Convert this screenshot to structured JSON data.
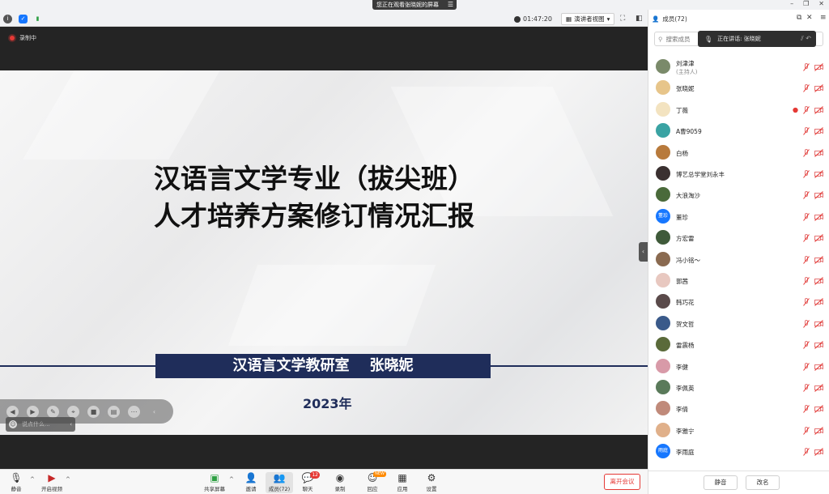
{
  "window": {
    "share_banner": "您正在观看张晓妮的屏幕",
    "timer": "01:47:20",
    "view_mode": "演讲者视图"
  },
  "stage": {
    "recording_label": "录制中",
    "slide": {
      "title_line1": "汉语言文学专业（拔尖班）",
      "title_line2": "人才培养方案修订情况汇报",
      "band_text": "汉语言文学教研室    张晓妮",
      "year": "2023年"
    },
    "chat_placeholder": "说点什么..."
  },
  "toolbar": {
    "mute": "静音",
    "start_video": "开启视频",
    "share_screen": "共享屏幕",
    "invite": "邀请",
    "members": "成员(72)",
    "chat": "聊天",
    "chat_badge": "12",
    "record": "录制",
    "reactions": "回应",
    "reactions_badge": "NEW",
    "apps": "应用",
    "settings": "设置",
    "leave": "离开会议"
  },
  "panel": {
    "title": "成员(72)",
    "search_placeholder": "搜索成员",
    "speaking": "正在讲话: 张晓妮",
    "participants": [
      {
        "name": "刘津津",
        "role": "(主持人)",
        "avatar_color": "#7a8a6a",
        "avatar_text": ""
      },
      {
        "name": "张晓妮",
        "role": "",
        "avatar_color": "#e7c58a",
        "avatar_text": ""
      },
      {
        "name": "丁薇",
        "role": "",
        "avatar_color": "#f3e3c0",
        "avatar_text": "",
        "recording": true
      },
      {
        "name": "A曹9059",
        "role": "",
        "avatar_color": "#3aa3a3",
        "avatar_text": ""
      },
      {
        "name": "白杨",
        "role": "",
        "avatar_color": "#b87a3c",
        "avatar_text": ""
      },
      {
        "name": "博艺总学堂刘永丰",
        "role": "",
        "avatar_color": "#3a3030",
        "avatar_text": ""
      },
      {
        "name": "大浪淘沙",
        "role": "",
        "avatar_color": "#4a6a3a",
        "avatar_text": ""
      },
      {
        "name": "董珍",
        "role": "",
        "avatar_color": "#1677ff",
        "avatar_text": "董珍"
      },
      {
        "name": "方宏雷",
        "role": "",
        "avatar_color": "#3f5a3a",
        "avatar_text": ""
      },
      {
        "name": "冯小铭～",
        "role": "",
        "avatar_color": "#8a6a50",
        "avatar_text": ""
      },
      {
        "name": "郭茜",
        "role": "",
        "avatar_color": "#e8c8c0",
        "avatar_text": ""
      },
      {
        "name": "韩巧花",
        "role": "",
        "avatar_color": "#5a4a4a",
        "avatar_text": ""
      },
      {
        "name": "贺文哲",
        "role": "",
        "avatar_color": "#3a5a8a",
        "avatar_text": ""
      },
      {
        "name": "雷震杨",
        "role": "",
        "avatar_color": "#5a6a3a",
        "avatar_text": ""
      },
      {
        "name": "李健",
        "role": "",
        "avatar_color": "#d89aa8",
        "avatar_text": ""
      },
      {
        "name": "李佩英",
        "role": "",
        "avatar_color": "#5a7a5a",
        "avatar_text": ""
      },
      {
        "name": "李倩",
        "role": "",
        "avatar_color": "#c08a7a",
        "avatar_text": ""
      },
      {
        "name": "李雅宁",
        "role": "",
        "avatar_color": "#e0b08a",
        "avatar_text": ""
      },
      {
        "name": "李雨庭",
        "role": "",
        "avatar_color": "#1677ff",
        "avatar_text": "雨庭"
      }
    ],
    "mute_all": "静音",
    "rename": "改名"
  }
}
